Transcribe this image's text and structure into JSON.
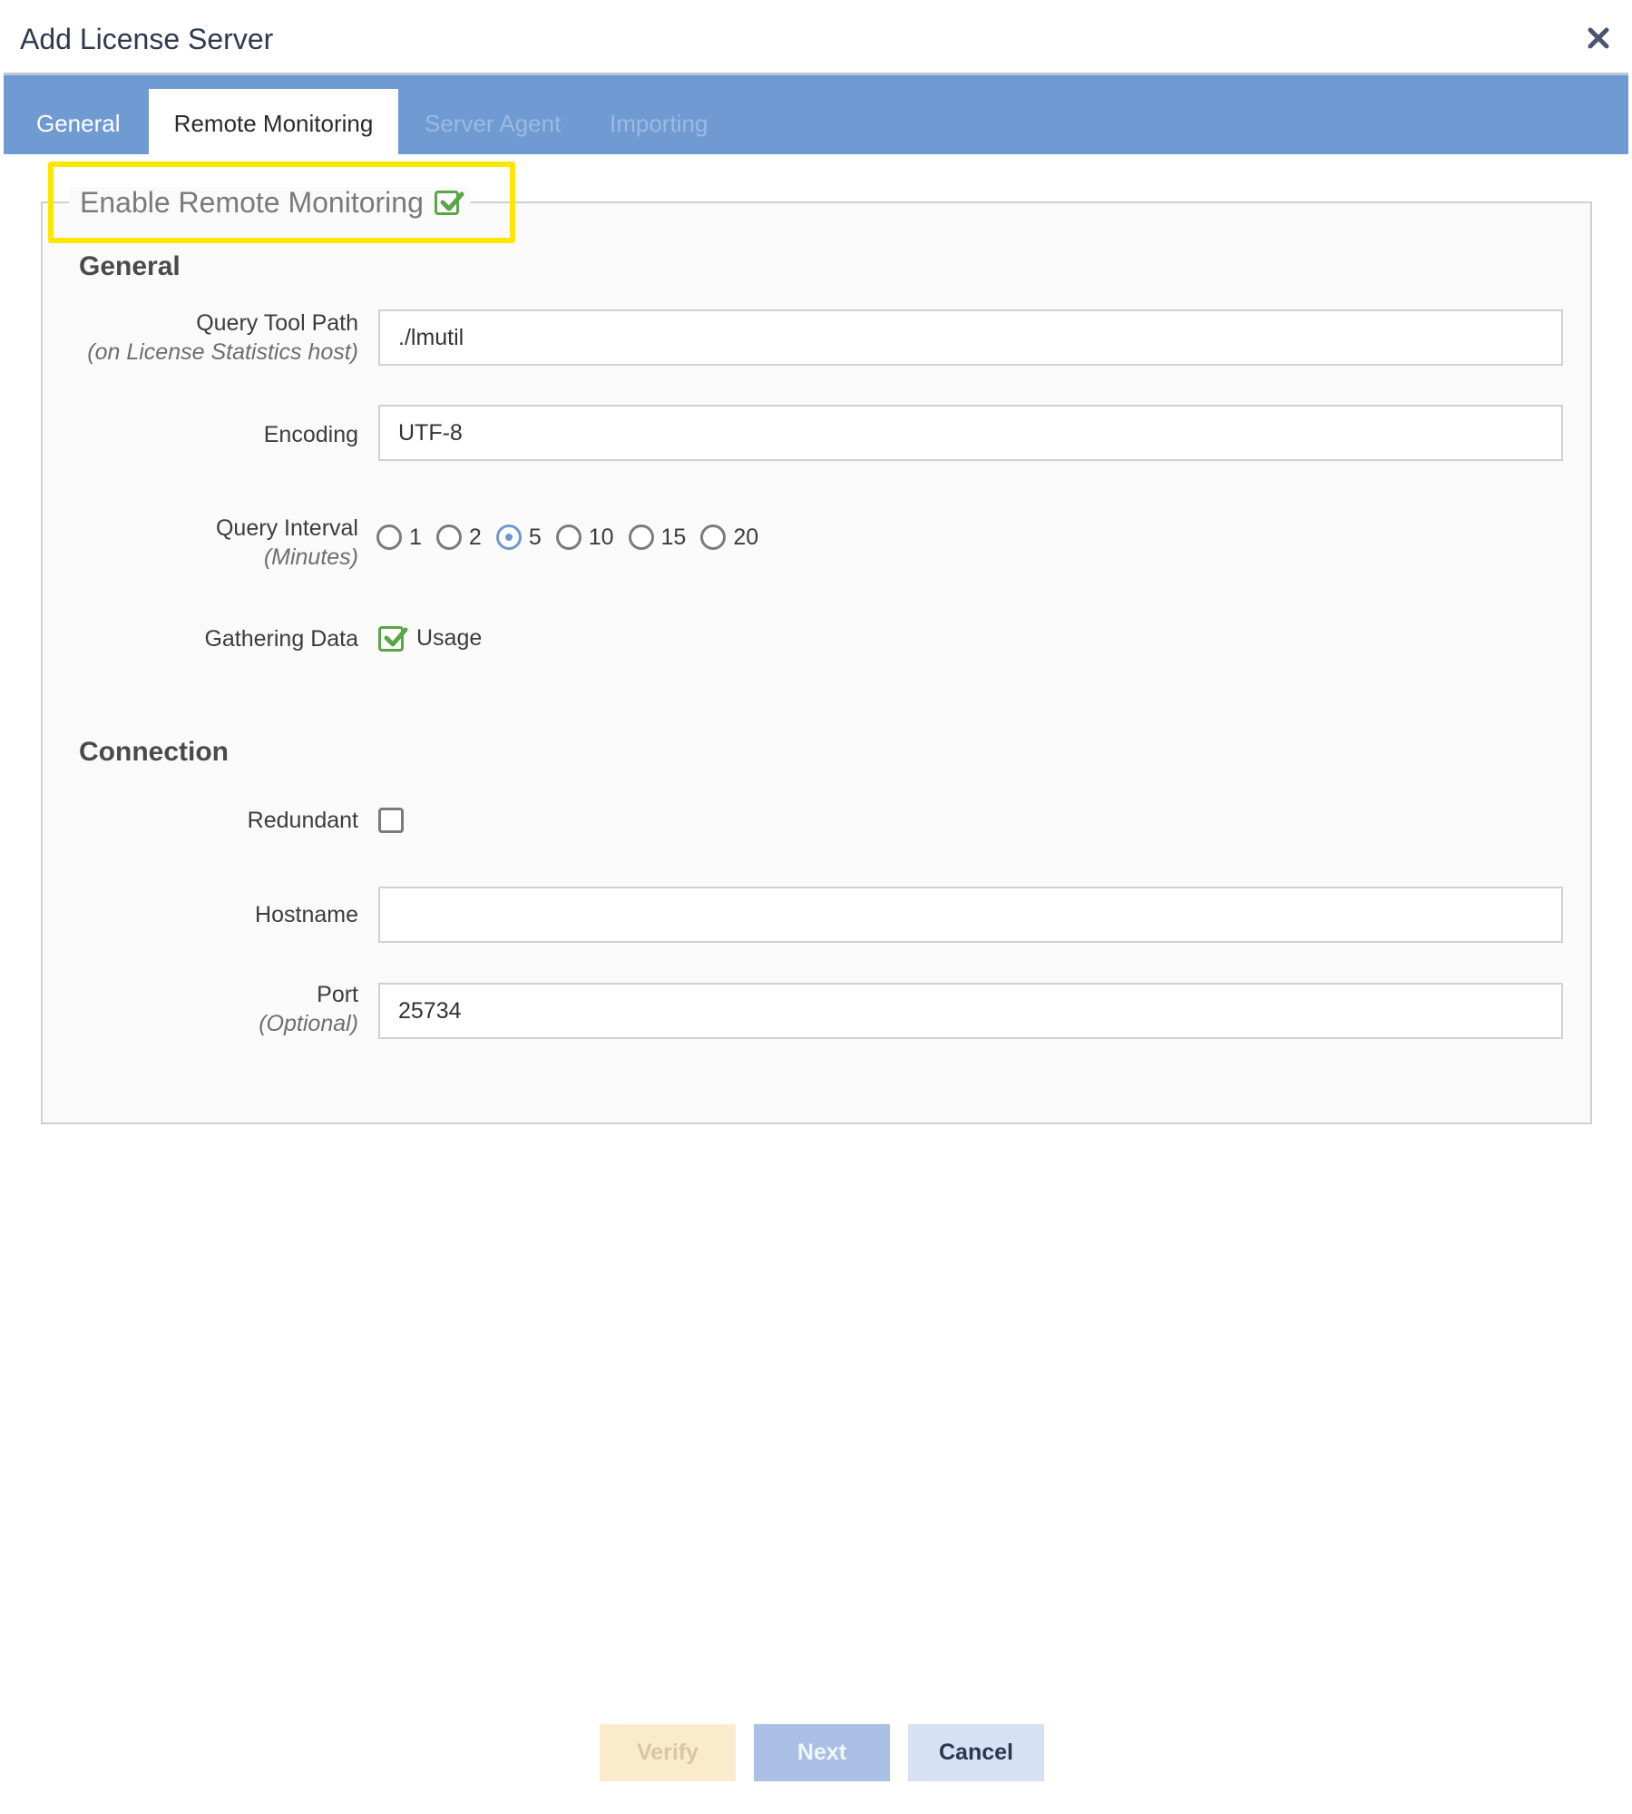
{
  "dialog": {
    "title": "Add License Server",
    "close_icon": "close-x-icon"
  },
  "tabs": [
    {
      "label": "General",
      "state": "inactive"
    },
    {
      "label": "Remote Monitoring",
      "state": "active"
    },
    {
      "label": "Server Agent",
      "state": "disabled"
    },
    {
      "label": "Importing",
      "state": "disabled"
    }
  ],
  "remote_monitoring": {
    "legend": "Enable Remote Monitoring",
    "enabled": true,
    "general_heading": "General",
    "query_tool_path": {
      "label": "Query Tool Path",
      "sublabel": "(on License Statistics host)",
      "value": "./lmutil"
    },
    "encoding": {
      "label": "Encoding",
      "value": "UTF-8"
    },
    "query_interval": {
      "label": "Query Interval",
      "sublabel": "(Minutes)",
      "options": [
        "1",
        "2",
        "5",
        "10",
        "15",
        "20"
      ],
      "selected": "5"
    },
    "gathering_data": {
      "label": "Gathering Data",
      "option_label": "Usage",
      "checked": true
    },
    "connection_heading": "Connection",
    "redundant": {
      "label": "Redundant",
      "checked": false
    },
    "hostname": {
      "label": "Hostname",
      "value": ""
    },
    "port": {
      "label": "Port",
      "sublabel": "(Optional)",
      "value": "25734"
    }
  },
  "buttons": {
    "verify": "Verify",
    "next": "Next",
    "cancel": "Cancel"
  },
  "colors": {
    "tab_bar": "#6f9ad2",
    "highlight": "#ffe600",
    "check_green": "#5aa646",
    "radio_selected": "#6f97d0"
  }
}
